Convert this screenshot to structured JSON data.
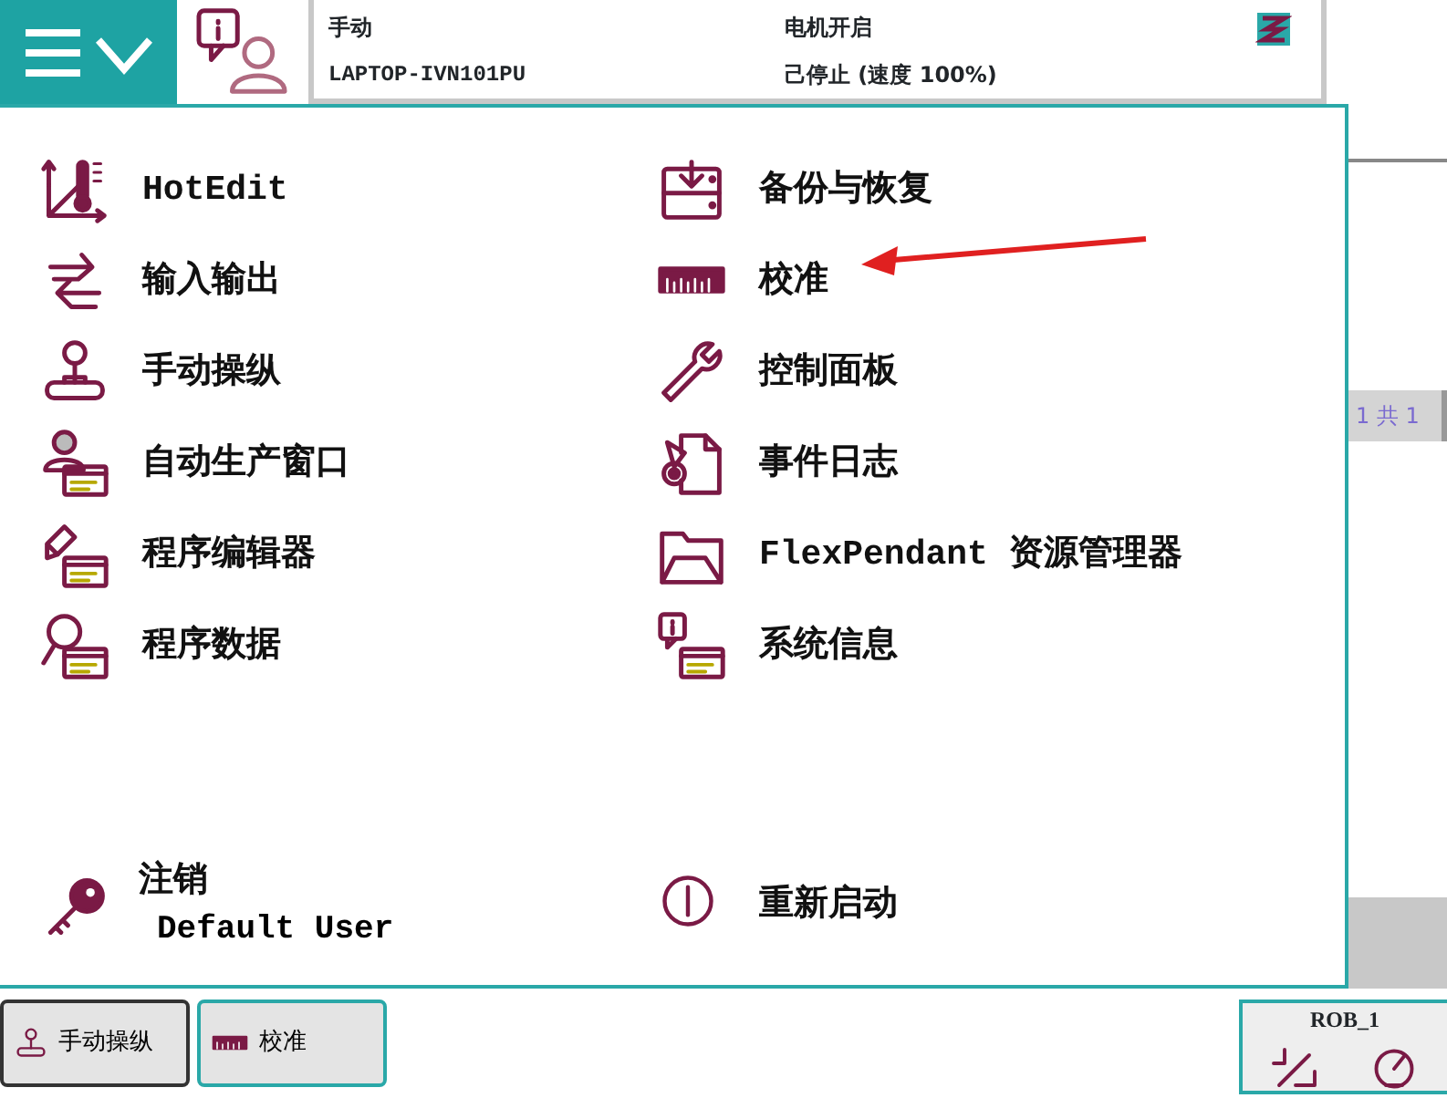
{
  "top_bar": {
    "mode": "手动",
    "system": "LAPTOP-IVN101PU",
    "motors": "电机开启",
    "state": "己停止 (速度 100%)"
  },
  "menu": {
    "left": [
      {
        "label": "HotEdit"
      },
      {
        "label": "输入输出"
      },
      {
        "label": "手动操纵"
      },
      {
        "label": "自动生产窗口"
      },
      {
        "label": "程序编辑器"
      },
      {
        "label": "程序数据"
      }
    ],
    "right": [
      {
        "label": "备份与恢复"
      },
      {
        "label": "校准"
      },
      {
        "label": "控制面板"
      },
      {
        "label": "事件日志"
      },
      {
        "label": "FlexPendant 资源管理器"
      },
      {
        "label": "系统信息"
      }
    ],
    "logout": {
      "label": "注销",
      "user": "Default User"
    },
    "restart": {
      "label": "重新启动"
    }
  },
  "side_strip": {
    "pager": "1 共 1"
  },
  "taskbar": {
    "items": [
      {
        "label": "手动操纵",
        "selected": false
      },
      {
        "label": "校准",
        "selected": true
      }
    ],
    "robot": "ROB_1"
  }
}
